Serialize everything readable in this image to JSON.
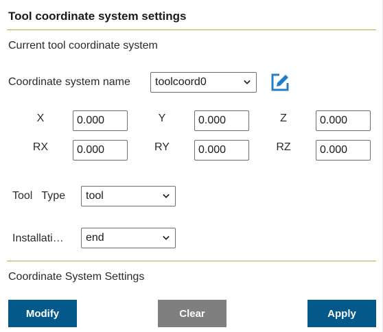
{
  "panel": {
    "title": "Tool coordinate system settings",
    "current_section": "Current tool coordinate system",
    "settings_section": "Coordinate System Settings"
  },
  "coordinate_system": {
    "label": "Coordinate system name",
    "selected": "toolcoord0",
    "edit_icon": "edit-square-pencil-icon"
  },
  "coordinates": {
    "x_label": "X",
    "x_value": "0.000",
    "y_label": "Y",
    "y_value": "0.000",
    "z_label": "Z",
    "z_value": "0.000",
    "rx_label": "RX",
    "rx_value": "0.000",
    "ry_label": "RY",
    "ry_value": "0.000",
    "rz_label": "RZ",
    "rz_value": "0.000"
  },
  "tool_type": {
    "label": "Tool   Type",
    "selected": "tool"
  },
  "installation": {
    "label": "Installati…",
    "selected": "end"
  },
  "buttons": {
    "modify": "Modify",
    "clear": "Clear",
    "apply": "Apply"
  },
  "colors": {
    "accent_line": "#a9b83a",
    "primary_button": "#03598a",
    "secondary_button": "#7f7f7f",
    "edit_icon": "#1e7fc7"
  }
}
